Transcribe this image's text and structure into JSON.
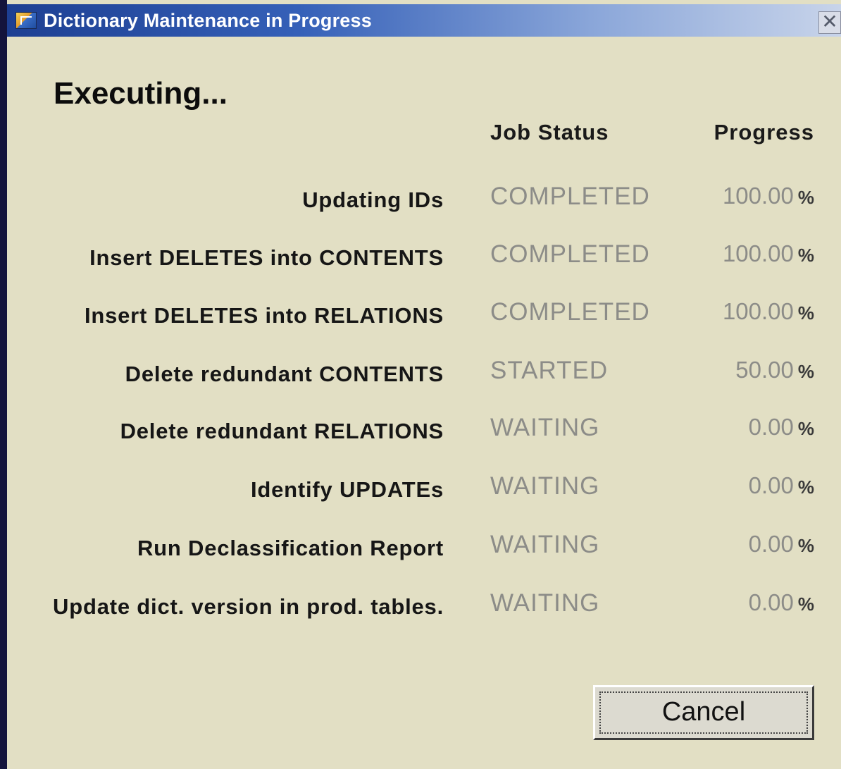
{
  "window": {
    "title": "Dictionary Maintenance in Progress",
    "close_glyph": "✕"
  },
  "heading": "Executing...",
  "columns": {
    "status": "Job Status",
    "progress": "Progress"
  },
  "jobs": [
    {
      "label": "Updating IDs",
      "status": "COMPLETED",
      "progress": "100.00",
      "unit": "%"
    },
    {
      "label": "Insert DELETES into CONTENTS",
      "status": "COMPLETED",
      "progress": "100.00",
      "unit": "%"
    },
    {
      "label": "Insert DELETES into RELATIONS",
      "status": "COMPLETED",
      "progress": "100.00",
      "unit": "%"
    },
    {
      "label": "Delete redundant CONTENTS",
      "status": "STARTED",
      "progress": "50.00",
      "unit": "%"
    },
    {
      "label": "Delete redundant RELATIONS",
      "status": "WAITING",
      "progress": "0.00",
      "unit": "%"
    },
    {
      "label": "Identify UPDATEs",
      "status": "WAITING",
      "progress": "0.00",
      "unit": "%"
    },
    {
      "label": "Run Declassification Report",
      "status": "WAITING",
      "progress": "0.00",
      "unit": "%"
    },
    {
      "label": "Update dict. version in prod. tables.",
      "status": "WAITING",
      "progress": "0.00",
      "unit": "%"
    }
  ],
  "buttons": {
    "cancel": "Cancel"
  },
  "icons": {
    "app": "dictionary-app-icon",
    "close": "close-icon"
  },
  "colors": {
    "dialog_background": "#e2dfc4",
    "status_text": "#8c8c88",
    "titlebar_start": "#1d3f92",
    "titlebar_end": "#c8d4ea"
  }
}
